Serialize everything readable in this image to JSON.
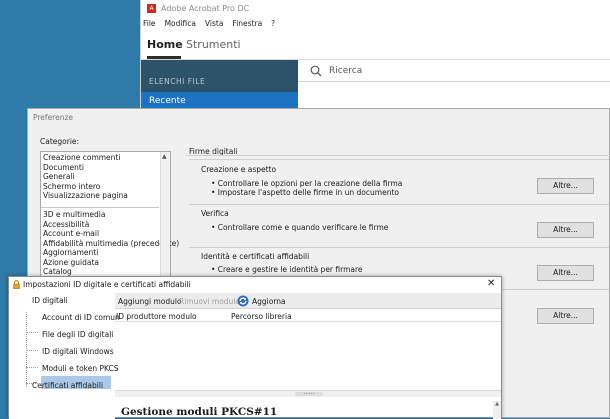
{
  "acrobat": {
    "title": "Adobe Acrobat Pro DC",
    "logo": "A",
    "menu": [
      "File",
      "Modifica",
      "Vista",
      "Finestra",
      "?"
    ],
    "tabs": {
      "home": "Home",
      "tools": "Strumenti"
    },
    "sidebar": {
      "header": "ELENCHI FILE",
      "recent": "Recente"
    },
    "search": {
      "placeholder": "Ricerca",
      "icon": "search-icon"
    }
  },
  "preferences": {
    "title": "Preferenze",
    "categories_label": "Categorie:",
    "categories_group1": [
      "Creazione commenti",
      "Documenti",
      "Generali",
      "Schermo intero",
      "Visualizzazione pagina"
    ],
    "categories_group2": [
      "3D e multimedia",
      "Accessibilità",
      "Account e-mail",
      "Affidabilità multimedia (precedente)",
      "Aggiornamenti",
      "Azione guidata",
      "Catalog"
    ],
    "section_title": "Firme digitali",
    "groups": [
      {
        "title": "Creazione e aspetto",
        "bullets": [
          "• Controllare le opzioni per la creazione della firma",
          "• Impostare l'aspetto delle firme in un documento"
        ],
        "button": "Altre..."
      },
      {
        "title": "Verifica",
        "bullets": [
          "• Controllare come e quando verificare le firme"
        ],
        "button": "Altre..."
      },
      {
        "title": "Identità e certificati affidabili",
        "bullets": [
          "• Creare e gestire le identità per firmare"
        ],
        "button": "Altre..."
      },
      {
        "title": "",
        "bullets": [],
        "button": "Altre..."
      }
    ]
  },
  "id_dialog": {
    "title": "Impostazioni ID digitale e certificati affidabili",
    "close": "✕",
    "tree": {
      "root": "ID digitali",
      "children": [
        "Account di ID comun",
        "File degli ID digitali",
        "ID digitali Windows",
        "Moduli e token PKCS"
      ],
      "trusted": "Certificati affidabili"
    },
    "toolbar": {
      "add": "Aggiungi modulo",
      "remove": "Rimuovi modulo",
      "refresh": "Aggiorna"
    },
    "columns": [
      "ID produttore modulo",
      "Percorso libreria"
    ],
    "heading": "Gestione moduli PKCS#11"
  },
  "colors": {
    "accent": "#1c73c4",
    "desktop": "#2e7aa8",
    "sidebar": "#2d536b",
    "acrobat_red": "#d9261c"
  }
}
